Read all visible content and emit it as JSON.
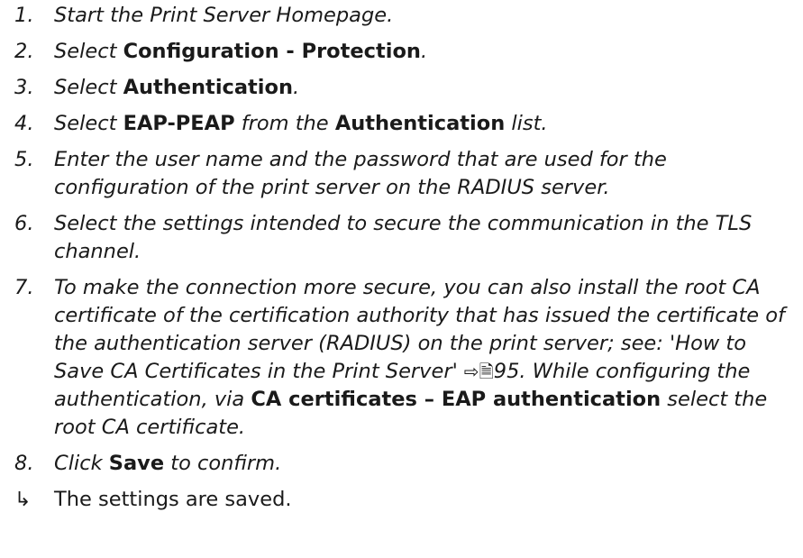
{
  "steps": [
    {
      "number": "1.",
      "parts": [
        {
          "text": "Start the Print Server Homepage.",
          "style": "i"
        }
      ]
    },
    {
      "number": "2.",
      "parts": [
        {
          "text": "Select ",
          "style": "i"
        },
        {
          "text": "Configuration - Protection",
          "style": "b"
        },
        {
          "text": ".",
          "style": "i"
        }
      ]
    },
    {
      "number": "3.",
      "parts": [
        {
          "text": "Select ",
          "style": "i"
        },
        {
          "text": "Authentication",
          "style": "b"
        },
        {
          "text": ".",
          "style": "i"
        }
      ]
    },
    {
      "number": "4.",
      "parts": [
        {
          "text": "Select ",
          "style": "i"
        },
        {
          "text": "EAP-PEAP",
          "style": "b"
        },
        {
          "text": " from the ",
          "style": "i"
        },
        {
          "text": "Authentication",
          "style": "b"
        },
        {
          "text": " list.",
          "style": "i"
        }
      ]
    },
    {
      "number": "5.",
      "parts": [
        {
          "text": "Enter the user name and the password that are used for the configuration of the print server on the RADIUS server.",
          "style": "i"
        }
      ]
    },
    {
      "number": "6.",
      "parts": [
        {
          "text": "Select the settings intended to secure the communication in the TLS channel.",
          "style": "i"
        }
      ]
    },
    {
      "number": "7.",
      "parts": [
        {
          "text": "To make the connection more secure, you can also install the root CA certificate of the certification authority that has issued the certificate of the authentication server (RADIUS) on the print server; see: 'How to Save CA Certificates in the Print Server' ",
          "style": "i"
        },
        {
          "text": "⇨🗎",
          "style": "ref"
        },
        {
          "text": "95. While configuring the authentication, via ",
          "style": "i"
        },
        {
          "text": "CA certificates – EAP authentication",
          "style": "b"
        },
        {
          "text": " select the root CA certificate.",
          "style": "i"
        }
      ]
    },
    {
      "number": "8.",
      "parts": [
        {
          "text": "Click ",
          "style": "i"
        },
        {
          "text": "Save",
          "style": "b"
        },
        {
          "text": " to confirm.",
          "style": "i"
        }
      ]
    }
  ],
  "result": {
    "icon": "result-arrow-icon",
    "symbol": "↳",
    "text": "The settings are saved."
  }
}
